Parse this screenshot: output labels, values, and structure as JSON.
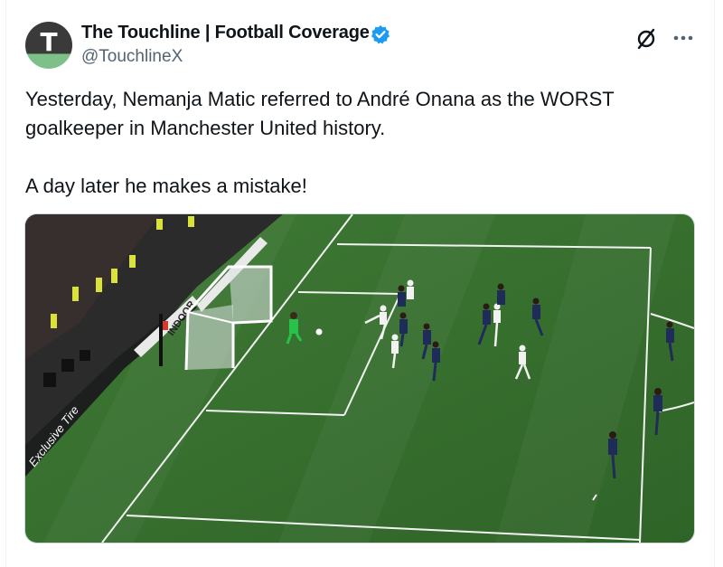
{
  "tweet": {
    "author": {
      "display_name": "The Touchline | Football Coverage",
      "handle": "@TouchlineX",
      "avatar_letter": "T",
      "verified": true,
      "verified_color": "#1d9bf0"
    },
    "text_lines": [
      "Yesterday, Nemanja Matic referred to André Onana as the WORST",
      "goalkeeper in Manchester United history.",
      "A day later he makes a mistake!"
    ],
    "icons": {
      "grok": "grok-icon",
      "more": "more-icon"
    },
    "media": {
      "kind": "match-photo",
      "board_texts": [
        "Exclusive Tire",
        "INDOOR"
      ]
    }
  }
}
